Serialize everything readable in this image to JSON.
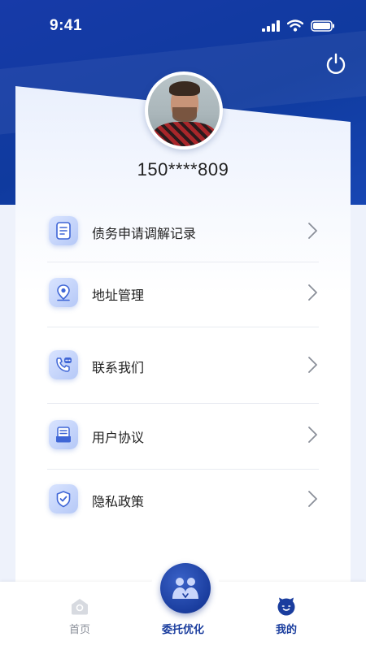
{
  "status_bar": {
    "time": "9:41"
  },
  "profile": {
    "phone": "150****809"
  },
  "menu": {
    "items": [
      {
        "label": "债务申请调解记录",
        "icon": "document-icon"
      },
      {
        "label": "地址管理",
        "icon": "location-icon"
      },
      {
        "label": "联系我们",
        "icon": "phone-chat-icon"
      },
      {
        "label": "用户协议",
        "icon": "agreement-icon"
      },
      {
        "label": "隐私政策",
        "icon": "shield-check-icon"
      }
    ]
  },
  "tabbar": {
    "home_label": "首页",
    "center_label": "委托优化",
    "mine_label": "我的"
  },
  "colors": {
    "brand_blue": "#1a3d9e",
    "header_blue": "#173aa8",
    "inactive_gray": "#8a8f99"
  }
}
